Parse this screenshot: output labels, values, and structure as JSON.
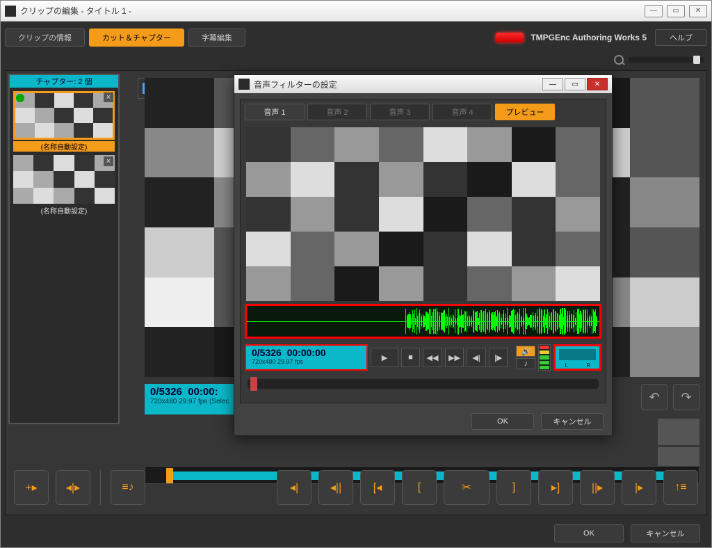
{
  "window": {
    "title": "クリップの編集 - タイトル 1 -"
  },
  "top_tabs": {
    "info": "クリップの情報",
    "cut": "カット＆チャプター",
    "sub": "字幕編集"
  },
  "brand": "TMPGEnc Authoring Works 5",
  "help": "ヘルプ",
  "sidebar": {
    "header": "チャプター: 2 個",
    "items": [
      {
        "label": "(名称自動設定)"
      },
      {
        "label": "(名称自動設定)"
      }
    ]
  },
  "main_time": {
    "frames": "0/5326",
    "code": "00:00:",
    "meta": "720x480 29.97 fps  (Selec"
  },
  "footer": {
    "ok": "OK",
    "cancel": "キャンセル"
  },
  "modal": {
    "title": "音声フィルターの設定",
    "tabs": {
      "a1": "音声 1",
      "a2": "音声 2",
      "a3": "音声 3",
      "a4": "音声 4",
      "preview": "プレビュー"
    },
    "time": {
      "frames": "0/5326",
      "code": "00:00:00",
      "meta": "720x480 29.97 fps"
    },
    "lr": {
      "L": "L",
      "R": "R"
    },
    "ok": "OK",
    "cancel": "キャンセル"
  }
}
